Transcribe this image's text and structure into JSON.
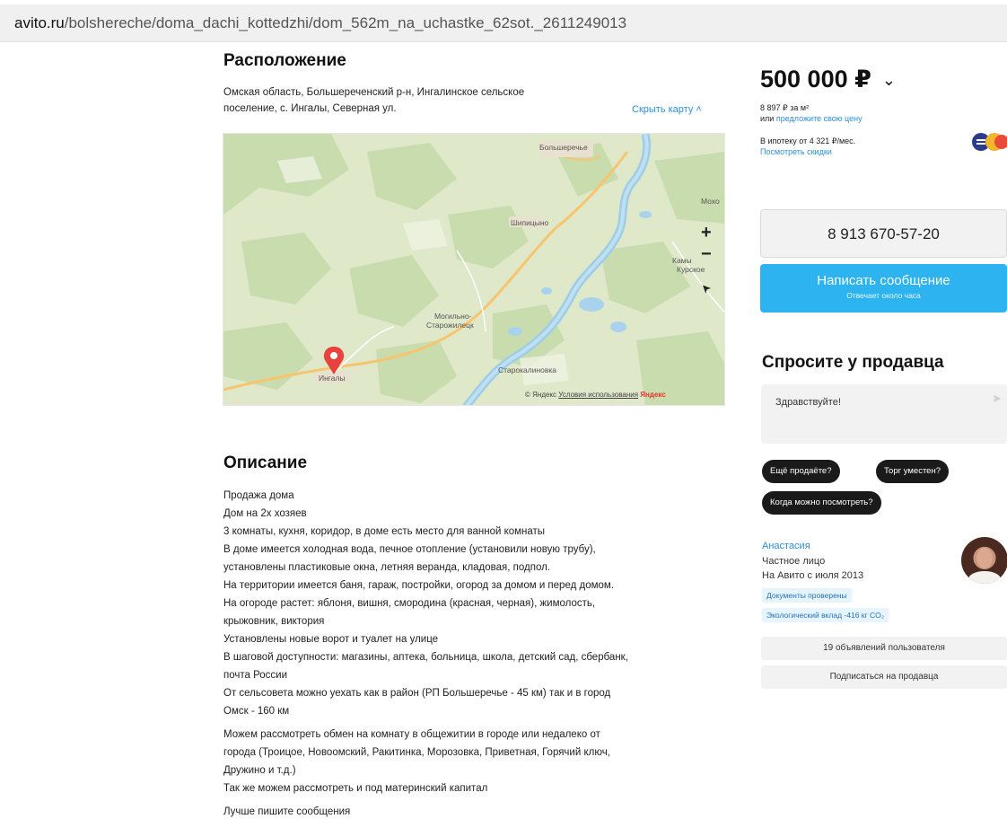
{
  "browser": {
    "url_domain": "avito.ru",
    "url_path": "/bolshereche/doma_dachi_kottedzhi/dom_562m_na_uchastke_62sot._2611249013"
  },
  "location": {
    "title": "Расположение",
    "address_line1": "Омская область, Большереченский р-н, Ингалинское сельское",
    "address_line2": "поселение, с. Ингалы, Северная ул.",
    "hide_map": "Скрыть карту",
    "map": {
      "labels": {
        "bolshereche": "Большеречье",
        "shipitsyno": "Шипицыно",
        "mogilno": "Могильно-",
        "mogilno2": "Старожилецк",
        "starokalinova": "Старокалиновка",
        "ingaly": "Ингалы",
        "kam": "Камы",
        "kursk": "Курское",
        "mor": "Мохо"
      },
      "zoom_in": "+",
      "zoom_out": "−",
      "locate": "➤",
      "copyright_prefix": "© Яндекс",
      "terms": "Условия использования",
      "yandex": "Яндекс"
    }
  },
  "description": {
    "title": "Описание",
    "lines": [
      "Продажа дома",
      "Дом на 2х хозяев",
      "3 комнаты, кухня, коридор, в доме есть место для ванной комнаты",
      "В доме имеется холодная вода, печное отопление (установили новую трубу),",
      "установлены пластиковые окна, летняя веранда, кладовая, подпол.",
      "На территории имеется баня, гараж, постройки, огород за домом и перед домом.",
      "На огороде растет: яблоня, вишня, смородина (красная, черная), жимолость,",
      "крыжовник, виктория",
      "Установлены новые ворот и туалет на улице",
      "В шаговой доступности: магазины, аптека, больница, школа, детский сад, сбербанк,",
      "почта России",
      "От сельсовета можно уехать как в район (РП Большеречье - 45 км) так и в город",
      "Омск - 160 км"
    ],
    "lines2": [
      "Можем рассмотреть обмен на комнату в общежитии в городе или недалеко от",
      "города (Троицое, Новоомский, Ракитинка, Морозовка, Приветная, Горячий ключ,",
      "Дружино и т.д.)",
      "Так же можем рассмотреть и под материнский капитал"
    ],
    "lines3": [
      "Лучше пишите сообщения"
    ]
  },
  "sidebar": {
    "price": "500 000 ₽",
    "price_chevron": "⌄",
    "per_sqm": "8 897 ₽ за м²",
    "offer_prefix": "или",
    "offer_link": "предложите свою цену",
    "mortgage": "В ипотеку от 4 321 ₽/мес.",
    "discounts": "Посмотреть скидки",
    "phone": "8 913 670-57-20",
    "write_message": "Написать сообщение",
    "reply_time": "Отвечает около часа",
    "ask_title": "Спросите у продавца",
    "ask_text": "Здравствуйте!",
    "send_icon": "➤",
    "chips": {
      "still_selling": "Ещё продаёте?",
      "bargain": "Торг уместен?",
      "when_view": "Когда можно посмотреть?"
    },
    "seller": {
      "name": "Анастасия",
      "type": "Частное лицо",
      "since": "На Авито с июля 2013",
      "docs_verified": "Документы проверены",
      "eco": "Экологический вклад -416 кг CO₂",
      "ads_count": "19 объявлений пользователя",
      "subscribe": "Подписаться на продавца"
    }
  }
}
